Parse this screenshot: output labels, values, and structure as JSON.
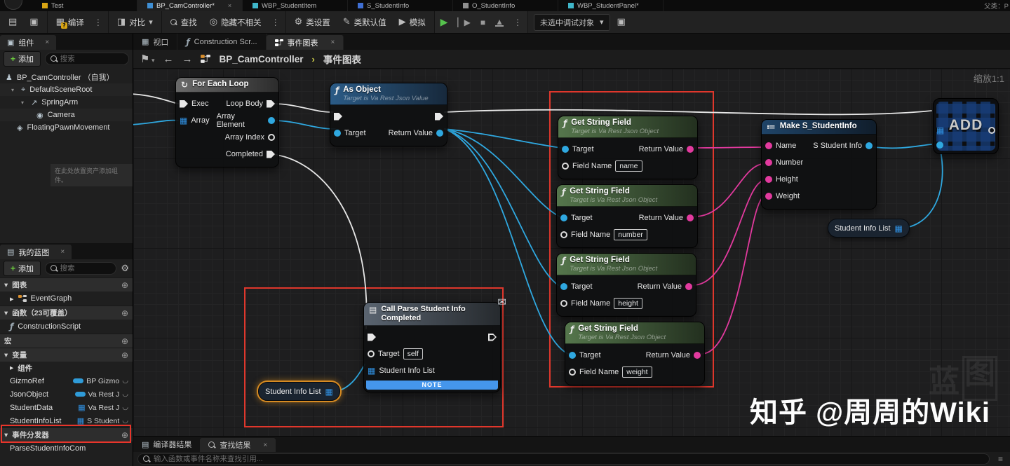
{
  "tabs_bar": {
    "tabs": [
      {
        "label": "Test"
      },
      {
        "label": "BP_CamController*",
        "active": true
      },
      {
        "label": "WBP_StudentItem"
      },
      {
        "label": "S_StudentInfo"
      },
      {
        "label": "O_StudentInfo"
      },
      {
        "label": "WBP_StudentPanel*"
      }
    ],
    "parent_class": "父类：P"
  },
  "toolbar": {
    "compile": "编译",
    "diff": "对比",
    "find": "查找",
    "hide_unrelated": "隐藏不相关",
    "class_settings": "类设置",
    "class_defaults": "类默认值",
    "simulate": "模拟",
    "debug_target": "未选中调试对象"
  },
  "components_panel": {
    "title": "组件",
    "add_label": "添加",
    "search_placeholder": "搜索",
    "tree": [
      {
        "label": "BP_CamController （自我）"
      },
      {
        "label": "DefaultSceneRoot"
      },
      {
        "label": "SpringArm"
      },
      {
        "label": "Camera"
      },
      {
        "label": "FloatingPawnMovement"
      }
    ],
    "drop_hint": "在此处放置资产添加组件。"
  },
  "my_blueprint": {
    "title": "我的蓝图",
    "add_label": "添加",
    "search_placeholder": "搜索",
    "sections": {
      "graphs": "图表",
      "event_graph": "EventGraph",
      "functions": "函数（23可覆盖）",
      "construction_script": "ConstructionScript",
      "macros": "宏",
      "variables": "变量",
      "components_group": "组件",
      "event_dispatchers": "事件分发器",
      "dispatcher_item": "ParseStudentInfoCom"
    },
    "variables": [
      {
        "name": "GizmoRef",
        "type": "BP Gizmo"
      },
      {
        "name": "JsonObject",
        "type": "Va Rest J"
      },
      {
        "name": "StudentData",
        "type": "Va Rest J"
      },
      {
        "name": "StudentInfoList",
        "type": "S Student"
      }
    ]
  },
  "graph": {
    "doc_tabs": [
      {
        "label": "视口"
      },
      {
        "label": "Construction Scr..."
      },
      {
        "label": "事件图表",
        "active": true
      }
    ],
    "breadcrumb": {
      "root": "BP_CamController",
      "current": "事件图表"
    },
    "zoom_label": "缩放1:1",
    "nodes": {
      "foreach": {
        "title": "For Each Loop",
        "exec_in": "Exec",
        "array_in": "Array",
        "loop_body": "Loop Body",
        "array_element": "Array Element",
        "array_index": "Array Index",
        "completed": "Completed"
      },
      "as_object": {
        "title": "As Object",
        "subtitle": "Target is Va Rest Json Value",
        "target": "Target",
        "return_value": "Return Value"
      },
      "get_string_fields": [
        {
          "title": "Get String Field",
          "subtitle": "Target is Va Rest Json Object",
          "target": "Target",
          "return_value": "Return Value",
          "field_label": "Field Name",
          "field_value": "name"
        },
        {
          "title": "Get String Field",
          "subtitle": "Target is Va Rest Json Object",
          "target": "Target",
          "return_value": "Return Value",
          "field_label": "Field Name",
          "field_value": "number"
        },
        {
          "title": "Get String Field",
          "subtitle": "Target is Va Rest Json Object",
          "target": "Target",
          "return_value": "Return Value",
          "field_label": "Field Name",
          "field_value": "height"
        },
        {
          "title": "Get String Field",
          "subtitle": "Target is Va Rest Json Object",
          "target": "Target",
          "return_value": "Return Value",
          "field_label": "Field Name",
          "field_value": "weight"
        }
      ],
      "make_struct": {
        "title": "Make S_StudentInfo",
        "inputs": [
          "Name",
          "Number",
          "Height",
          "Weight"
        ],
        "output": "S Student Info"
      },
      "add_node": {
        "label": "ADD"
      },
      "call_parse": {
        "title": "Call Parse Student Info Completed",
        "target_label": "Target",
        "target_value": "self",
        "list_label": "Student Info List",
        "note_label": "NOTE"
      },
      "var_getter_label": "Student Info List"
    }
  },
  "bottom_panel": {
    "compiler_tab": "编译器结果",
    "find_tab": "查找结果",
    "search_placeholder": "输入函数或事件名称来查找引用..."
  },
  "watermark": {
    "credit": "知乎 @周周的Wiki",
    "logo_text_1": "蓝",
    "logo_text_2": "图"
  },
  "colors": {
    "accent_blue": "#2fa8e0",
    "pin_pink": "#e23a9e",
    "red_highlight": "#df372c",
    "select_orange": "#d78b22",
    "note_blue": "#4596ec"
  }
}
